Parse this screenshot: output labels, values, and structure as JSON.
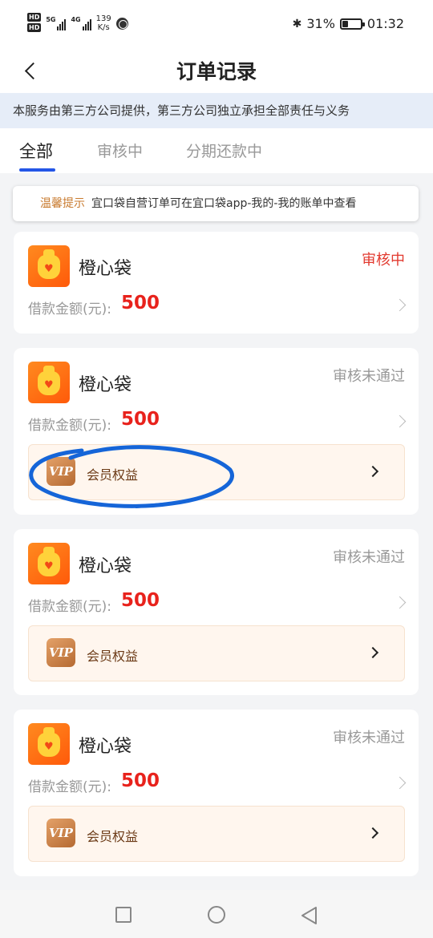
{
  "status_bar": {
    "hd_top": "HD",
    "hd_bottom": "HD",
    "signal_1": "5G",
    "signal_2": "4G",
    "net_speed_value": "139",
    "net_speed_unit": "K/s",
    "battery_percent": "31%",
    "battery_level": 0.31,
    "time": "01:32"
  },
  "header": {
    "title": "订单记录"
  },
  "notice": {
    "text": "本服务由第三方公司提供，第三方公司独立承担全部责任与义务"
  },
  "tabs": [
    {
      "label": "全部",
      "active": true
    },
    {
      "label": "审核中",
      "active": false
    },
    {
      "label": "分期还款中",
      "active": false
    }
  ],
  "tip": {
    "label": "温馨提示",
    "text": "宜口袋自营订单可在宜口袋app-我的-我的账单中查看"
  },
  "orders": [
    {
      "brand": "橙心袋",
      "status": "审核中",
      "amount_label": "借款金额(元):",
      "amount": "500"
    },
    {
      "brand": "橙心袋",
      "status": "审核未通过",
      "amount_label": "借款金额(元):",
      "amount": "500",
      "vip_label": "会员权益",
      "vip_icon_text": "VIP"
    },
    {
      "brand": "橙心袋",
      "status": "审核未通过",
      "amount_label": "借款金额(元):",
      "amount": "500",
      "vip_label": "会员权益",
      "vip_icon_text": "VIP"
    },
    {
      "brand": "橙心袋",
      "status": "审核未通过",
      "amount_label": "借款金额(元):",
      "amount": "500",
      "vip_label": "会员权益",
      "vip_icon_text": "VIP"
    }
  ],
  "colors": {
    "accent": "#2456e6",
    "amount_red": "#e8221c",
    "status_pending": "#e23a2f",
    "status_rejected": "#999999",
    "tip_label": "#c87a2e",
    "annotation_ink": "#1565d8"
  }
}
